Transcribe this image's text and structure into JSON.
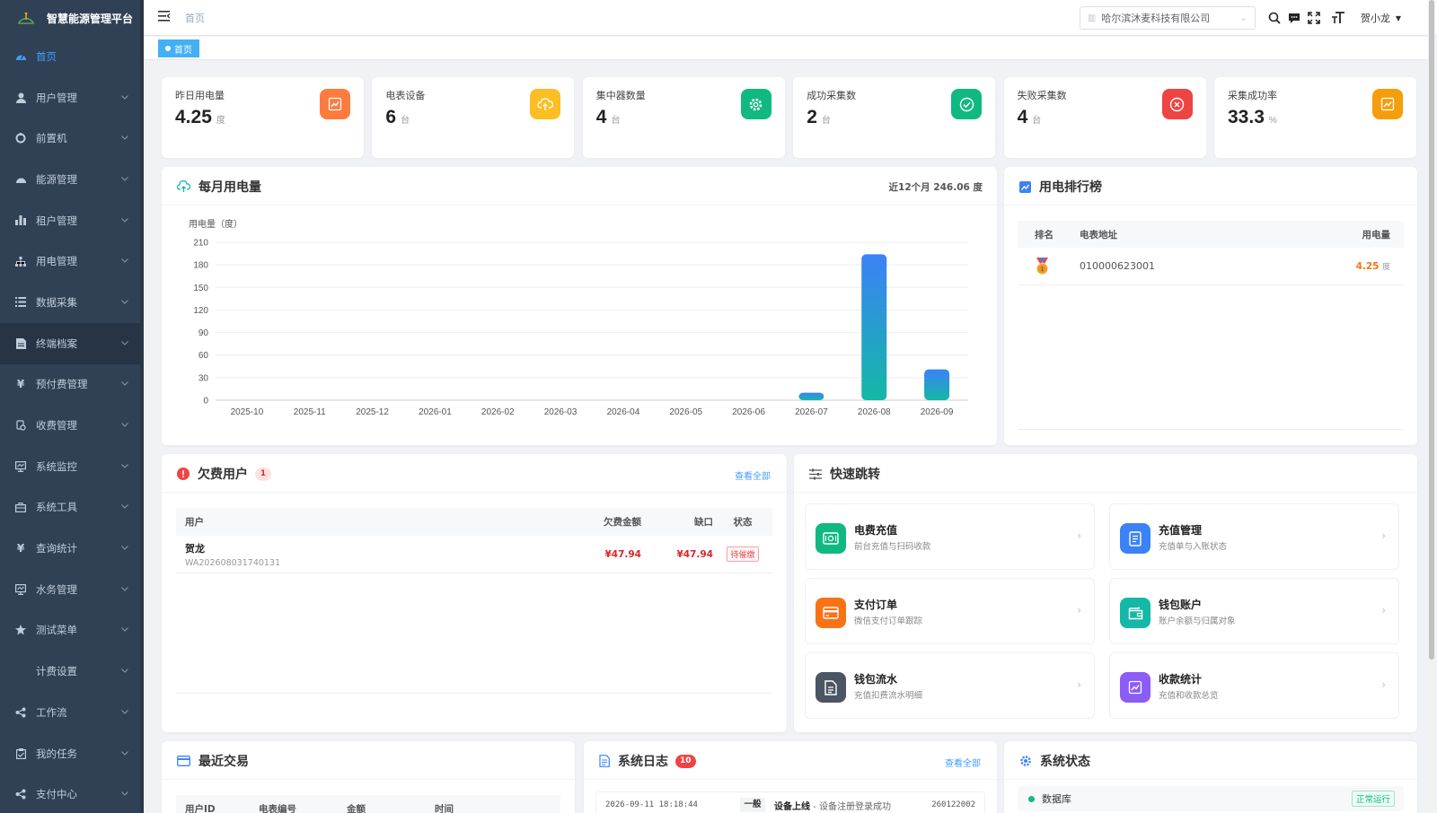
{
  "app": {
    "title": "智慧能源管理平台"
  },
  "sidebar": {
    "items": [
      {
        "label": "首页",
        "icon": "dashboard-icon"
      },
      {
        "label": "用户管理",
        "icon": "user-icon"
      },
      {
        "label": "前置机",
        "icon": "server-icon"
      },
      {
        "label": "能源管理",
        "icon": "energy-icon"
      },
      {
        "label": "租户管理",
        "icon": "bar-chart-icon"
      },
      {
        "label": "用电管理",
        "icon": "tree-icon"
      },
      {
        "label": "数据采集",
        "icon": "list-icon"
      },
      {
        "label": "终端档案",
        "icon": "archive-icon"
      },
      {
        "label": "预付费管理",
        "icon": "yen-icon"
      },
      {
        "label": "收费管理",
        "icon": "money-icon"
      },
      {
        "label": "系统监控",
        "icon": "monitor-icon"
      },
      {
        "label": "系统工具",
        "icon": "toolbox-icon"
      },
      {
        "label": "查询统计",
        "icon": "yen-icon"
      },
      {
        "label": "水务管理",
        "icon": "monitor-icon"
      },
      {
        "label": "测试菜单",
        "icon": "star-icon"
      },
      {
        "label": "计费设置",
        "icon": ""
      },
      {
        "label": "工作流",
        "icon": "share-icon"
      },
      {
        "label": "我的任务",
        "icon": "task-icon"
      },
      {
        "label": "支付中心",
        "icon": "share-icon"
      }
    ]
  },
  "header": {
    "breadcrumb": "首页",
    "company": "哈尔滨沐麦科技有限公司",
    "user": "贺小龙"
  },
  "tags": {
    "home": "首页"
  },
  "stats": [
    {
      "label": "昨日用电量",
      "value": "4.25",
      "unit": "度",
      "color": "#ff7a3d",
      "icon": "trend-icon"
    },
    {
      "label": "电表设备",
      "value": "6",
      "unit": "台",
      "color": "#fbbf24",
      "icon": "cloud-upload-icon"
    },
    {
      "label": "集中器数量",
      "value": "4",
      "unit": "台",
      "color": "#10b981",
      "icon": "gear-icon"
    },
    {
      "label": "成功采集数",
      "value": "2",
      "unit": "台",
      "color": "#10b981",
      "icon": "check-circle-icon"
    },
    {
      "label": "失败采集数",
      "value": "4",
      "unit": "台",
      "color": "#ef4444",
      "icon": "x-circle-icon"
    },
    {
      "label": "采集成功率",
      "value": "33.3",
      "unit": "%",
      "color": "#f59e0b",
      "icon": "trend-icon"
    }
  ],
  "monthly": {
    "title": "每月用电量",
    "summary": "近12个月 246.06 度"
  },
  "chart_data": {
    "type": "bar",
    "title": "",
    "ylabel": "用电量（度）",
    "xlabel": "",
    "categories": [
      "2025-10",
      "2025-11",
      "2025-12",
      "2026-01",
      "2026-02",
      "2026-03",
      "2026-04",
      "2026-05",
      "2026-06",
      "2026-07",
      "2026-08",
      "2026-09"
    ],
    "values": [
      0,
      0,
      0,
      0,
      0,
      0,
      0,
      0,
      0,
      10,
      194,
      41
    ],
    "ylim": [
      0,
      210
    ],
    "yticks": [
      0,
      30,
      60,
      90,
      120,
      150,
      180,
      210
    ],
    "grid": true,
    "colors": [
      "#3b82f6",
      "#14b8a6"
    ]
  },
  "ranking": {
    "title": "用电排行榜",
    "headers": [
      "排名",
      "电表地址",
      "用电量"
    ],
    "rows": [
      {
        "rank": "1",
        "address": "010000623001",
        "value": "4.25",
        "unit": "度"
      }
    ]
  },
  "arrears": {
    "title": "欠费用户",
    "count": "1",
    "more": "查看全部",
    "headers": [
      "用户",
      "欠费金额",
      "缺口",
      "状态"
    ],
    "rows": [
      {
        "name": "贺龙",
        "account": "WA202608031740131",
        "amount": "¥47.94",
        "gap": "¥47.94",
        "status": "待催缴"
      }
    ]
  },
  "quick": {
    "title": "快速跳转",
    "items": [
      {
        "title": "电费充值",
        "sub": "前台充值与扫码收款",
        "color": "#10b981",
        "icon": "recharge-icon"
      },
      {
        "title": "充值管理",
        "sub": "充值单与入账状态",
        "color": "#3b82f6",
        "icon": "document-icon"
      },
      {
        "title": "支付订单",
        "sub": "微信支付订单跟踪",
        "color": "#f97316",
        "icon": "card-icon"
      },
      {
        "title": "钱包账户",
        "sub": "账户余额与归属对象",
        "color": "#14b8a6",
        "icon": "wallet-icon"
      },
      {
        "title": "钱包流水",
        "sub": "充值扣费流水明细",
        "color": "#4b5563",
        "icon": "file-icon"
      },
      {
        "title": "收款统计",
        "sub": "充值和收款总览",
        "color": "#8b5cf6",
        "icon": "trend-icon"
      }
    ]
  },
  "transactions": {
    "title": "最近交易",
    "headers": [
      "用户ID",
      "电表编号",
      "金额",
      "时间"
    ]
  },
  "logs": {
    "title": "系统日志",
    "count": "10",
    "more": "查看全部",
    "rows": [
      {
        "time": "2026-09-11 18:18:44",
        "level": "一般",
        "event": "设备上线",
        "detail": " - 设备注册登录成功",
        "id": "260122002"
      }
    ]
  },
  "system": {
    "title": "系统状态",
    "rows": [
      {
        "name": "数据库",
        "status": "正常运行"
      }
    ]
  }
}
